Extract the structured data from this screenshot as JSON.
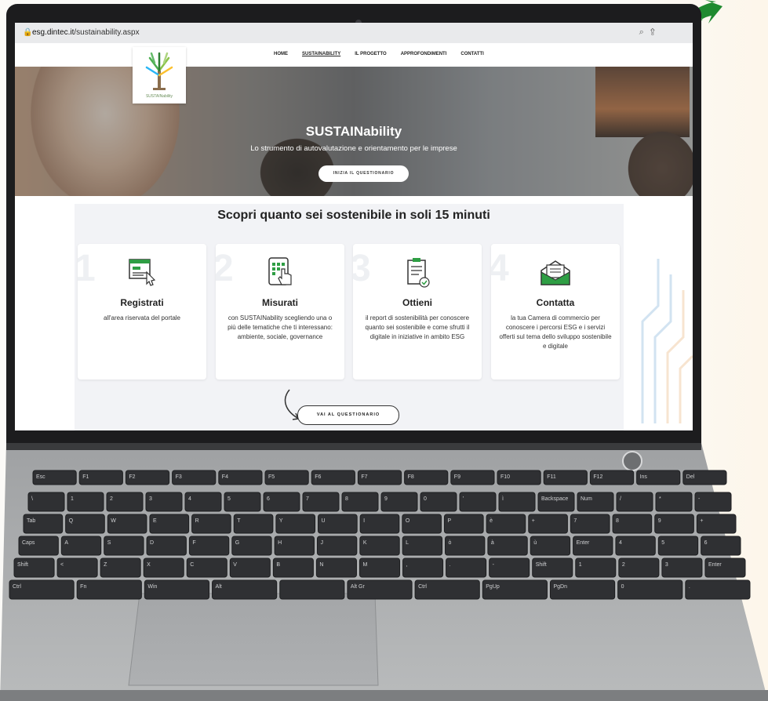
{
  "browser": {
    "url_domain": "esg.dintec.it",
    "url_path": "/sustainability.aspx",
    "tools_icons": [
      "zoom-icon",
      "share-icon"
    ]
  },
  "nav": {
    "items": [
      {
        "label": "HOME",
        "active": false
      },
      {
        "label": "SUSTAINABILITY",
        "active": true
      },
      {
        "label": "IL PROGETTO",
        "active": false
      },
      {
        "label": "APPROFONDIMENTI",
        "active": false
      },
      {
        "label": "CONTATTI",
        "active": false
      }
    ],
    "logo_caption": "SUSTAINability"
  },
  "hero": {
    "title": "SUSTAINability",
    "subtitle": "Lo strumento di autovalutazione e orientamento per le imprese",
    "cta_label": "INIZIA IL QUESTIONARIO"
  },
  "main": {
    "heading": "Scopri quanto sei sostenibile in soli 15 minuti",
    "cards": [
      {
        "num": "1",
        "icon": "registration-form-icon",
        "title": "Registrati",
        "desc": "all'area riservata del portale"
      },
      {
        "num": "2",
        "icon": "tablet-touch-icon",
        "title": "Misurati",
        "desc": "con SUSTAINability scegliendo una o più delle tematiche che ti interessano: ambiente, sociale, governance"
      },
      {
        "num": "3",
        "icon": "report-clipboard-icon",
        "title": "Ottieni",
        "desc": "il report di sostenibilità per conoscere quanto sei sostenibile e come sfrutti il digitale in iniziative in ambito ESG"
      },
      {
        "num": "4",
        "icon": "envelope-icon",
        "title": "Contatta",
        "desc": "la tua Camera di commercio per conoscere i percorsi ESG e i servizi offerti sul tema dello sviluppo sostenibile e digitale"
      }
    ],
    "cta_label": "VAI AL QUESTIONARIO"
  },
  "colors": {
    "accent_green": "#2e9e44",
    "text_dark": "#222222",
    "laptop_body": "#8c8e90",
    "bezel": "#1c1c1e"
  },
  "keyboard": {
    "row1": [
      "Esc",
      "F1",
      "F2",
      "F3",
      "F4",
      "F5",
      "F6",
      "F7",
      "F8",
      "F9",
      "F10",
      "F11",
      "F12",
      "Ins",
      "Del"
    ],
    "row2": [
      "\\",
      "1",
      "2",
      "3",
      "4",
      "5",
      "6",
      "7",
      "8",
      "9",
      "0",
      "'",
      "ì",
      "Backspace",
      "Num",
      "/",
      "*",
      "-"
    ],
    "row3": [
      "Tab",
      "Q",
      "W",
      "E",
      "R",
      "T",
      "Y",
      "U",
      "I",
      "O",
      "P",
      "è",
      "+",
      "7",
      "8",
      "9",
      "+"
    ],
    "row4": [
      "Caps",
      "A",
      "S",
      "D",
      "F",
      "G",
      "H",
      "J",
      "K",
      "L",
      "ò",
      "à",
      "ù",
      "Enter",
      "4",
      "5",
      "6"
    ],
    "row5": [
      "Shift",
      "<",
      "Z",
      "X",
      "C",
      "V",
      "B",
      "N",
      "M",
      ",",
      ".",
      "-",
      "Shift",
      "1",
      "2",
      "3",
      "Enter"
    ],
    "row6": [
      "Ctrl",
      "Fn",
      "Win",
      "Alt",
      "",
      "Alt Gr",
      "Ctrl",
      "PgUp",
      "PgDn",
      "0",
      "."
    ]
  }
}
